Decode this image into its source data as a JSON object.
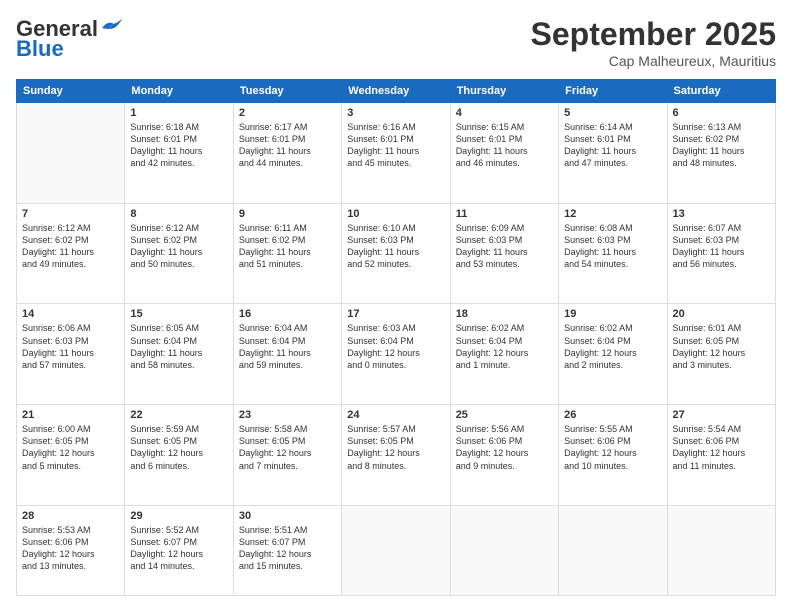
{
  "header": {
    "logo_general": "General",
    "logo_blue": "Blue",
    "month_title": "September 2025",
    "subtitle": "Cap Malheureux, Mauritius"
  },
  "days_of_week": [
    "Sunday",
    "Monday",
    "Tuesday",
    "Wednesday",
    "Thursday",
    "Friday",
    "Saturday"
  ],
  "weeks": [
    [
      {
        "day": "",
        "info": ""
      },
      {
        "day": "1",
        "info": "Sunrise: 6:18 AM\nSunset: 6:01 PM\nDaylight: 11 hours\nand 42 minutes."
      },
      {
        "day": "2",
        "info": "Sunrise: 6:17 AM\nSunset: 6:01 PM\nDaylight: 11 hours\nand 44 minutes."
      },
      {
        "day": "3",
        "info": "Sunrise: 6:16 AM\nSunset: 6:01 PM\nDaylight: 11 hours\nand 45 minutes."
      },
      {
        "day": "4",
        "info": "Sunrise: 6:15 AM\nSunset: 6:01 PM\nDaylight: 11 hours\nand 46 minutes."
      },
      {
        "day": "5",
        "info": "Sunrise: 6:14 AM\nSunset: 6:01 PM\nDaylight: 11 hours\nand 47 minutes."
      },
      {
        "day": "6",
        "info": "Sunrise: 6:13 AM\nSunset: 6:02 PM\nDaylight: 11 hours\nand 48 minutes."
      }
    ],
    [
      {
        "day": "7",
        "info": "Sunrise: 6:12 AM\nSunset: 6:02 PM\nDaylight: 11 hours\nand 49 minutes."
      },
      {
        "day": "8",
        "info": "Sunrise: 6:12 AM\nSunset: 6:02 PM\nDaylight: 11 hours\nand 50 minutes."
      },
      {
        "day": "9",
        "info": "Sunrise: 6:11 AM\nSunset: 6:02 PM\nDaylight: 11 hours\nand 51 minutes."
      },
      {
        "day": "10",
        "info": "Sunrise: 6:10 AM\nSunset: 6:03 PM\nDaylight: 11 hours\nand 52 minutes."
      },
      {
        "day": "11",
        "info": "Sunrise: 6:09 AM\nSunset: 6:03 PM\nDaylight: 11 hours\nand 53 minutes."
      },
      {
        "day": "12",
        "info": "Sunrise: 6:08 AM\nSunset: 6:03 PM\nDaylight: 11 hours\nand 54 minutes."
      },
      {
        "day": "13",
        "info": "Sunrise: 6:07 AM\nSunset: 6:03 PM\nDaylight: 11 hours\nand 56 minutes."
      }
    ],
    [
      {
        "day": "14",
        "info": "Sunrise: 6:06 AM\nSunset: 6:03 PM\nDaylight: 11 hours\nand 57 minutes."
      },
      {
        "day": "15",
        "info": "Sunrise: 6:05 AM\nSunset: 6:04 PM\nDaylight: 11 hours\nand 58 minutes."
      },
      {
        "day": "16",
        "info": "Sunrise: 6:04 AM\nSunset: 6:04 PM\nDaylight: 11 hours\nand 59 minutes."
      },
      {
        "day": "17",
        "info": "Sunrise: 6:03 AM\nSunset: 6:04 PM\nDaylight: 12 hours\nand 0 minutes."
      },
      {
        "day": "18",
        "info": "Sunrise: 6:02 AM\nSunset: 6:04 PM\nDaylight: 12 hours\nand 1 minute."
      },
      {
        "day": "19",
        "info": "Sunrise: 6:02 AM\nSunset: 6:04 PM\nDaylight: 12 hours\nand 2 minutes."
      },
      {
        "day": "20",
        "info": "Sunrise: 6:01 AM\nSunset: 6:05 PM\nDaylight: 12 hours\nand 3 minutes."
      }
    ],
    [
      {
        "day": "21",
        "info": "Sunrise: 6:00 AM\nSunset: 6:05 PM\nDaylight: 12 hours\nand 5 minutes."
      },
      {
        "day": "22",
        "info": "Sunrise: 5:59 AM\nSunset: 6:05 PM\nDaylight: 12 hours\nand 6 minutes."
      },
      {
        "day": "23",
        "info": "Sunrise: 5:58 AM\nSunset: 6:05 PM\nDaylight: 12 hours\nand 7 minutes."
      },
      {
        "day": "24",
        "info": "Sunrise: 5:57 AM\nSunset: 6:05 PM\nDaylight: 12 hours\nand 8 minutes."
      },
      {
        "day": "25",
        "info": "Sunrise: 5:56 AM\nSunset: 6:06 PM\nDaylight: 12 hours\nand 9 minutes."
      },
      {
        "day": "26",
        "info": "Sunrise: 5:55 AM\nSunset: 6:06 PM\nDaylight: 12 hours\nand 10 minutes."
      },
      {
        "day": "27",
        "info": "Sunrise: 5:54 AM\nSunset: 6:06 PM\nDaylight: 12 hours\nand 11 minutes."
      }
    ],
    [
      {
        "day": "28",
        "info": "Sunrise: 5:53 AM\nSunset: 6:06 PM\nDaylight: 12 hours\nand 13 minutes."
      },
      {
        "day": "29",
        "info": "Sunrise: 5:52 AM\nSunset: 6:07 PM\nDaylight: 12 hours\nand 14 minutes."
      },
      {
        "day": "30",
        "info": "Sunrise: 5:51 AM\nSunset: 6:07 PM\nDaylight: 12 hours\nand 15 minutes."
      },
      {
        "day": "",
        "info": ""
      },
      {
        "day": "",
        "info": ""
      },
      {
        "day": "",
        "info": ""
      },
      {
        "day": "",
        "info": ""
      }
    ]
  ]
}
